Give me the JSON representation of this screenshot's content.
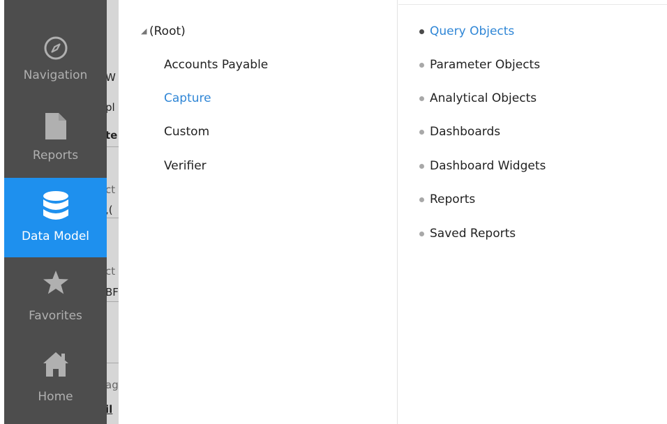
{
  "nav": {
    "items": [
      {
        "label": "Navigation",
        "icon": "compass-icon"
      },
      {
        "label": "Reports",
        "icon": "document-icon"
      },
      {
        "label": "Data Model",
        "icon": "database-icon",
        "active": true
      },
      {
        "label": "Favorites",
        "icon": "star-icon"
      },
      {
        "label": "Home",
        "icon": "home-icon"
      }
    ]
  },
  "tree": {
    "root_label": "(Root)",
    "children": [
      "Accounts Payable",
      "Capture",
      "Custom",
      "Verifier"
    ],
    "selected": "Capture"
  },
  "object_types": {
    "items": [
      "Query Objects",
      "Parameter Objects",
      "Analytical Objects",
      "Dashboards",
      "Dashboard Widgets",
      "Reports",
      "Saved Reports"
    ],
    "selected": "Query Objects"
  },
  "behind_fragments": [
    "W",
    "pl",
    "te",
    "ct",
    ",(",
    "ct",
    "BF",
    "ag",
    "il"
  ],
  "colors": {
    "nav_bg": "#4d4d4d",
    "nav_active": "#1e90ee",
    "link_blue": "#2f86d6"
  }
}
